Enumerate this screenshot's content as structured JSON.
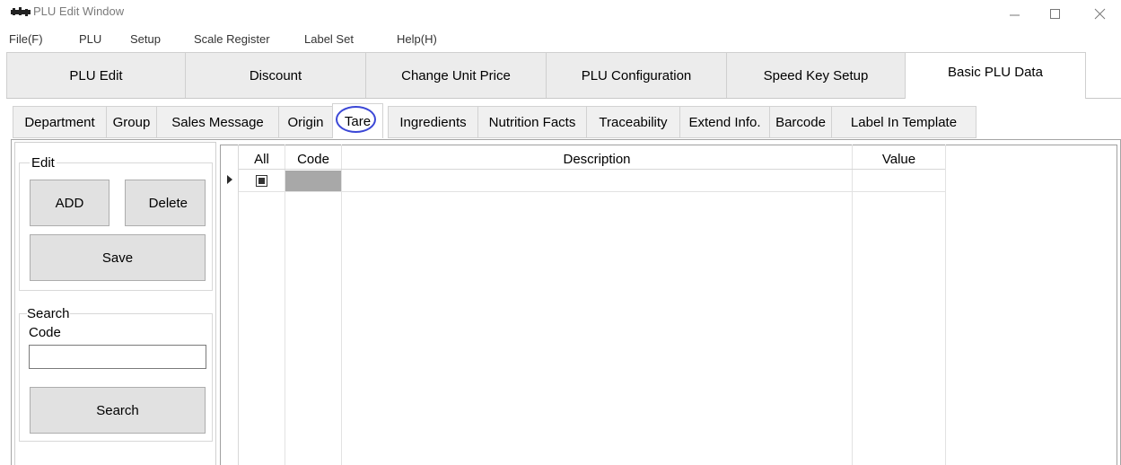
{
  "window": {
    "title": "PLU Edit Window"
  },
  "menu": [
    "File(F)",
    "PLU",
    "Setup",
    "Scale Register",
    "Label Set",
    "Help(H)"
  ],
  "main_tabs": [
    "PLU Edit",
    "Discount",
    "Change Unit Price",
    "PLU Configuration",
    "Speed Key Setup",
    "Basic PLU Data"
  ],
  "active_main_tab": "Basic PLU Data",
  "sub_tabs": [
    "Department",
    "Group",
    "Sales Message",
    "Origin",
    "Tare",
    "Ingredients",
    "Nutrition Facts",
    "Traceability",
    "Extend Info.",
    "Barcode",
    "Label In Template"
  ],
  "active_sub_tab": "Tare",
  "edit_group": {
    "legend": "Edit",
    "add_label": "ADD",
    "delete_label": "Delete",
    "save_label": "Save"
  },
  "search_group": {
    "legend": "Search",
    "code_label": "Code",
    "code_value": "",
    "search_label": "Search"
  },
  "grid": {
    "columns": [
      "All",
      "Code",
      "Description",
      "Value"
    ],
    "rows": [
      {
        "selected": true,
        "code": "",
        "description": "",
        "value": ""
      }
    ]
  }
}
